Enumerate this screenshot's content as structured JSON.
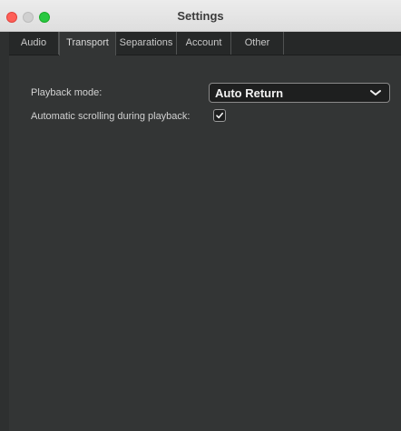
{
  "window": {
    "title": "Settings"
  },
  "tabs": [
    {
      "label": "Audio",
      "active": false
    },
    {
      "label": "Transport",
      "active": true
    },
    {
      "label": "Separations",
      "active": false
    },
    {
      "label": "Account",
      "active": false
    },
    {
      "label": "Other",
      "active": false
    }
  ],
  "transport": {
    "playback_mode_label": "Playback mode:",
    "playback_mode_value": "Auto Return",
    "auto_scroll_label": "Automatic scrolling during playback:",
    "auto_scroll_checked": true
  },
  "icons": {
    "dropdown": "chevron-down-icon",
    "check": "checkmark-icon"
  },
  "colors": {
    "close": "#fe5f57",
    "zoom": "#28c840",
    "background": "#333535"
  }
}
